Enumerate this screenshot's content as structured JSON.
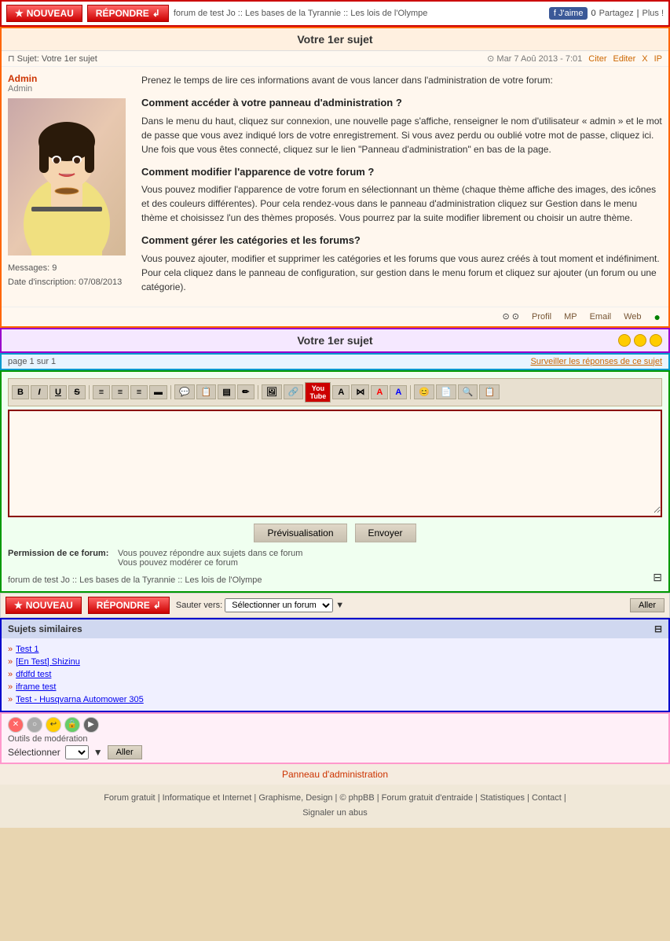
{
  "header": {
    "btn_nouveau": "NOUVEAU",
    "btn_repondre": "RÉPONDRE",
    "breadcrumb": "forum de test Jo :: Les bases de la Tyrannie :: Les lois de l'Olympe",
    "fb_like": "J'aime",
    "share": "Partagez",
    "plus": "Plus !",
    "table_label": "Table 1"
  },
  "post": {
    "title": "Votre 1er sujet",
    "subject_label": "Sujet:",
    "subject_value": "Votre 1er sujet",
    "date": "Mar 7 Aoû 2013 - 7:01",
    "action_cite": "Citer",
    "action_editer": "Editer",
    "action_x": "X",
    "action_ip": "IP",
    "author": "Admin",
    "author_role": "Admin",
    "messages_label": "Messages:",
    "messages_count": "9",
    "inscription_label": "Date d'inscription:",
    "inscription_date": "07/08/2013",
    "footer_profil": "Profil",
    "footer_mp": "MP",
    "footer_email": "Email",
    "footer_web": "Web",
    "content_intro": "Prenez le temps de lire ces informations avant de vous lancer dans l'administration de votre forum:",
    "section1_title": "Comment accéder à votre panneau d'administration ?",
    "section1_text": "Dans le menu du haut, cliquez sur connexion, une nouvelle page s'affiche, renseigner le nom d'utilisateur « admin » et le mot de passe que vous avez indiqué lors de votre enregistrement. Si vous avez perdu ou oublié votre mot de passe, cliquez ici. Une fois que vous êtes connecté, cliquez sur le lien \"Panneau d'administration\" en bas de la page.",
    "section2_title": "Comment modifier l'apparence de votre forum ?",
    "section2_text": "Vous pouvez modifier l'apparence de votre forum en sélectionnant un thème (chaque thème affiche des images, des icônes et des couleurs différentes). Pour cela rendez-vous dans le panneau d'administration cliquez sur Gestion dans le menu thème et choisissez l'un des thèmes proposés. Vous pourrez par la suite modifier librement ou choisir un autre thème.",
    "section3_title": "Comment gérer les catégories et les forums?",
    "section3_text": "Vous pouvez ajouter, modifier et supprimer les catégories et les forums que vous aurez créés à tout moment et indéfiniment. Pour cela cliquez dans le panneau de configuration, sur gestion dans le menu forum et cliquez sur ajouter (un forum ou une catégorie).",
    "table_label": "Table 2"
  },
  "subject_bar": {
    "title": "Votre 1er sujet",
    "table_label": "Table 3"
  },
  "page_bar": {
    "page_info": "page 1 sur 1",
    "surveil": "Surveiller les réponses de ce sujet",
    "table_label": "Table 4"
  },
  "editor": {
    "toolbar_buttons": [
      "B",
      "I",
      "U",
      "S",
      "|",
      "≡",
      "≡",
      "≡",
      "▬",
      "|",
      "💬",
      "📋",
      "🔲",
      "✏️",
      "|",
      "📋",
      "📋",
      "🔗",
      "▶",
      "A",
      "⋈",
      "A",
      "A",
      "|",
      "😊",
      "📄",
      "🔍",
      "📋"
    ],
    "toolbar_b": "B",
    "toolbar_i": "I",
    "toolbar_u": "U",
    "toolbar_s": "S",
    "btn_preview": "Prévisualisation",
    "btn_send": "Envoyer",
    "perm_label": "Permission de ce forum:",
    "perm_reply": "Vous pouvez répondre aux sujets dans ce forum",
    "perm_moderate": "Vous pouvez modérer ce forum",
    "breadcrumb": "forum de test Jo :: Les bases de la Tyrannie :: Les lois de l'Olympe",
    "table_label": "Table 8"
  },
  "bottom_nav": {
    "btn_nouveau": "NOUVEAU",
    "btn_repondre": "RÉPONDRE",
    "jump_label": "Sauter vers:",
    "jump_placeholder": "Sélectionner un forum",
    "btn_aller": "Aller",
    "table_label": "Table 9"
  },
  "similar_topics": {
    "header": "Sujets similaires",
    "items": [
      "Test 1",
      "[En Test] Shizinu",
      "dfdfd test",
      "iframe test",
      "Test - Husqvarna Automower 305"
    ],
    "table_label": "Table 6"
  },
  "moderation": {
    "label": "Outils de modération",
    "select_label": "Sélectionner",
    "btn_aller": "Aller",
    "table_label": "Table 10"
  },
  "admin_link": "Panneau d'administration",
  "footer": {
    "links": [
      "Forum gratuit",
      "Informatique et Internet",
      "Graphisme, Design",
      "© phpBB",
      "Forum gratuit d'entraide",
      "Statistiques",
      "Contact",
      "Signaler un abus"
    ]
  }
}
